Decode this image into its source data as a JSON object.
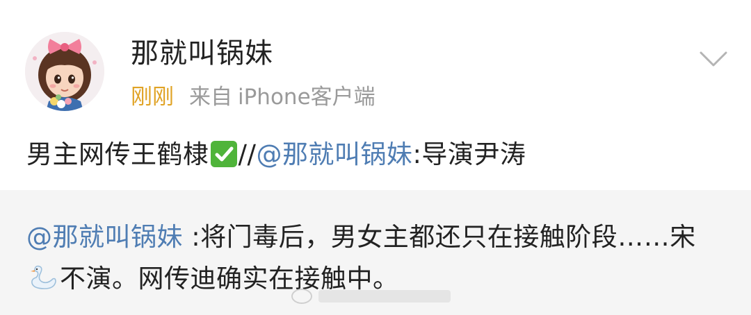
{
  "post": {
    "author": {
      "username": "那就叫锅妹",
      "avatar_icon": "cartoon-girl-avatar-icon"
    },
    "meta": {
      "time": "刚刚",
      "source_prefix": "来自",
      "source_client": "iPhone客户端"
    },
    "more_icon": "chevron-down-icon",
    "content": {
      "text_before": "男主网传王鹤棣",
      "emoji": "check-mark-button-icon",
      "separator": "//",
      "mention": "@那就叫锅妹",
      "text_after": ":导演尹涛"
    },
    "repost": {
      "mention": "@那就叫锅妹",
      "text_part1": " :将门毒后，男女主都还只在接触阶段……宋",
      "emoji": "swan-icon",
      "text_part2": "不演。网传迪确实在接触中。"
    }
  },
  "colors": {
    "time": "#e0a325",
    "meta_gray": "#9a9a9a",
    "mention_blue": "#4f7db3",
    "text": "#222222",
    "repost_bg": "#f5f5f5",
    "check_green": "#4fb43a"
  }
}
